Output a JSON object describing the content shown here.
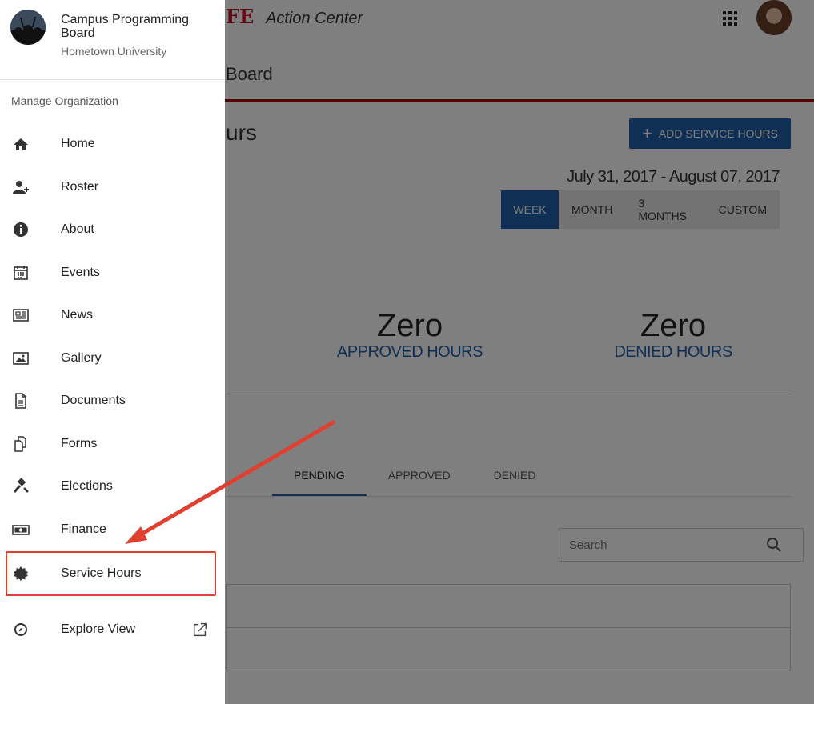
{
  "app": {
    "brand_mark": "FE",
    "brand_subtitle": "Action Center",
    "org_title": "Board",
    "page_heading": "urs",
    "add_button_label": "ADD SERVICE HOURS",
    "date_range": "July 31, 2017 - August 07, 2017",
    "range_tabs": [
      {
        "label": "WEEK",
        "active": true
      },
      {
        "label": "MONTH",
        "active": false
      },
      {
        "label": "3 MONTHS",
        "active": false
      },
      {
        "label": "CUSTOM",
        "active": false
      }
    ],
    "stats": [
      {
        "value": "Zero",
        "label": "APPROVED HOURS"
      },
      {
        "value": "Zero",
        "label": "DENIED HOURS"
      }
    ],
    "status_tabs": [
      {
        "label": "PENDING",
        "active": true
      },
      {
        "label": "APPROVED",
        "active": false
      },
      {
        "label": "DENIED",
        "active": false
      }
    ],
    "search_placeholder": "Search"
  },
  "drawer": {
    "org_name": "Campus Programming Board",
    "org_school": "Hometown University",
    "section_label": "Manage Organization",
    "items": [
      {
        "label": "Home",
        "icon": "home-icon"
      },
      {
        "label": "Roster",
        "icon": "add-user-icon"
      },
      {
        "label": "About",
        "icon": "info-icon"
      },
      {
        "label": "Events",
        "icon": "calendar-icon"
      },
      {
        "label": "News",
        "icon": "newspaper-icon"
      },
      {
        "label": "Gallery",
        "icon": "image-icon"
      },
      {
        "label": "Documents",
        "icon": "document-icon"
      },
      {
        "label": "Forms",
        "icon": "forms-icon"
      },
      {
        "label": "Elections",
        "icon": "gavel-icon"
      },
      {
        "label": "Finance",
        "icon": "money-icon"
      },
      {
        "label": "Service Hours",
        "icon": "badge-icon"
      }
    ],
    "explore_label": "Explore View"
  },
  "colors": {
    "accent_blue": "#1f5fa8",
    "brand_red": "#c8102e",
    "annotation_red": "#e0402f"
  }
}
